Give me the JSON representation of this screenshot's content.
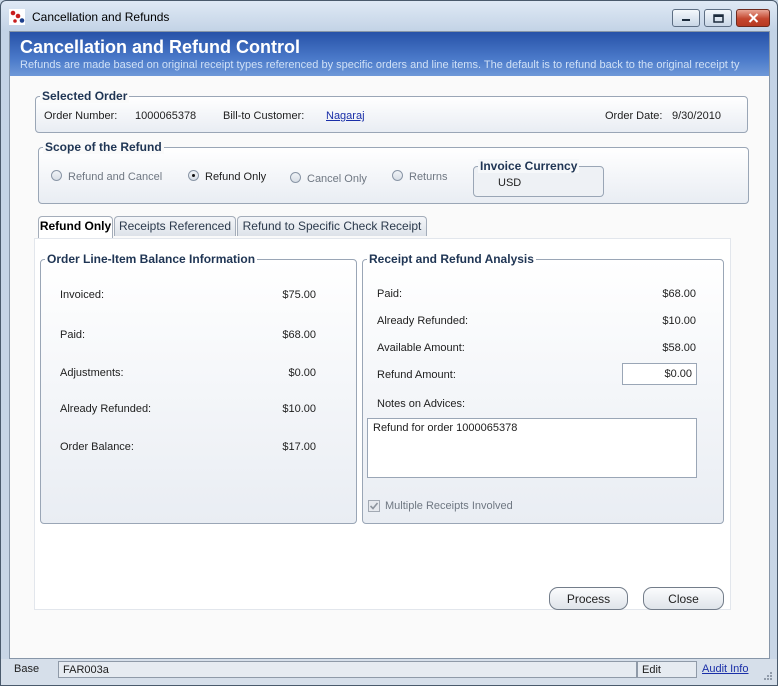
{
  "window": {
    "title": "Cancellation and Refunds"
  },
  "banner": {
    "title": "Cancellation and Refund Control",
    "subtitle": "Refunds are made based on original receipt types referenced by specific orders and line items. The default is to refund back to the original receipt ty"
  },
  "selected_order": {
    "legend": "Selected Order",
    "order_number_label": "Order Number:",
    "order_number": "1000065378",
    "customer_label": "Bill-to Customer:",
    "customer": "Nagaraj",
    "order_date_label": "Order Date:",
    "order_date": "9/30/2010"
  },
  "scope": {
    "legend": "Scope of the Refund",
    "options": [
      "Refund and Cancel",
      "Refund Only",
      "Cancel Only",
      "Returns"
    ],
    "selected": "Refund Only",
    "currency_legend": "Invoice Currency",
    "currency": "USD"
  },
  "tabs": [
    "Refund Only",
    "Receipts Referenced",
    "Refund to Specific Check Receipt"
  ],
  "line_items": {
    "legend": "Order Line-Item Balance Information",
    "rows": [
      {
        "label": "Invoiced:",
        "value": "$75.00"
      },
      {
        "label": "Paid:",
        "value": "$68.00"
      },
      {
        "label": "Adjustments:",
        "value": "$0.00"
      },
      {
        "label": "Already Refunded:",
        "value": "$10.00"
      },
      {
        "label": "Order Balance:",
        "value": "$17.00"
      }
    ]
  },
  "analysis": {
    "legend": "Receipt and Refund Analysis",
    "rows": [
      {
        "label": "Paid:",
        "value": "$68.00"
      },
      {
        "label": "Already Refunded:",
        "value": "$10.00"
      },
      {
        "label": "Available Amount:",
        "value": "$58.00"
      }
    ],
    "refund_amount_label": "Refund Amount:",
    "refund_amount": "$0.00",
    "notes_label": "Notes on Advices:",
    "notes": "Refund for order 1000065378",
    "multiple_receipts_label": "Multiple Receipts Involved",
    "multiple_receipts_checked": true
  },
  "buttons": {
    "process": "Process",
    "close": "Close"
  },
  "status": {
    "mode": "Base",
    "form_id": "FAR003a",
    "state": "Edit",
    "audit": "Audit Info"
  }
}
